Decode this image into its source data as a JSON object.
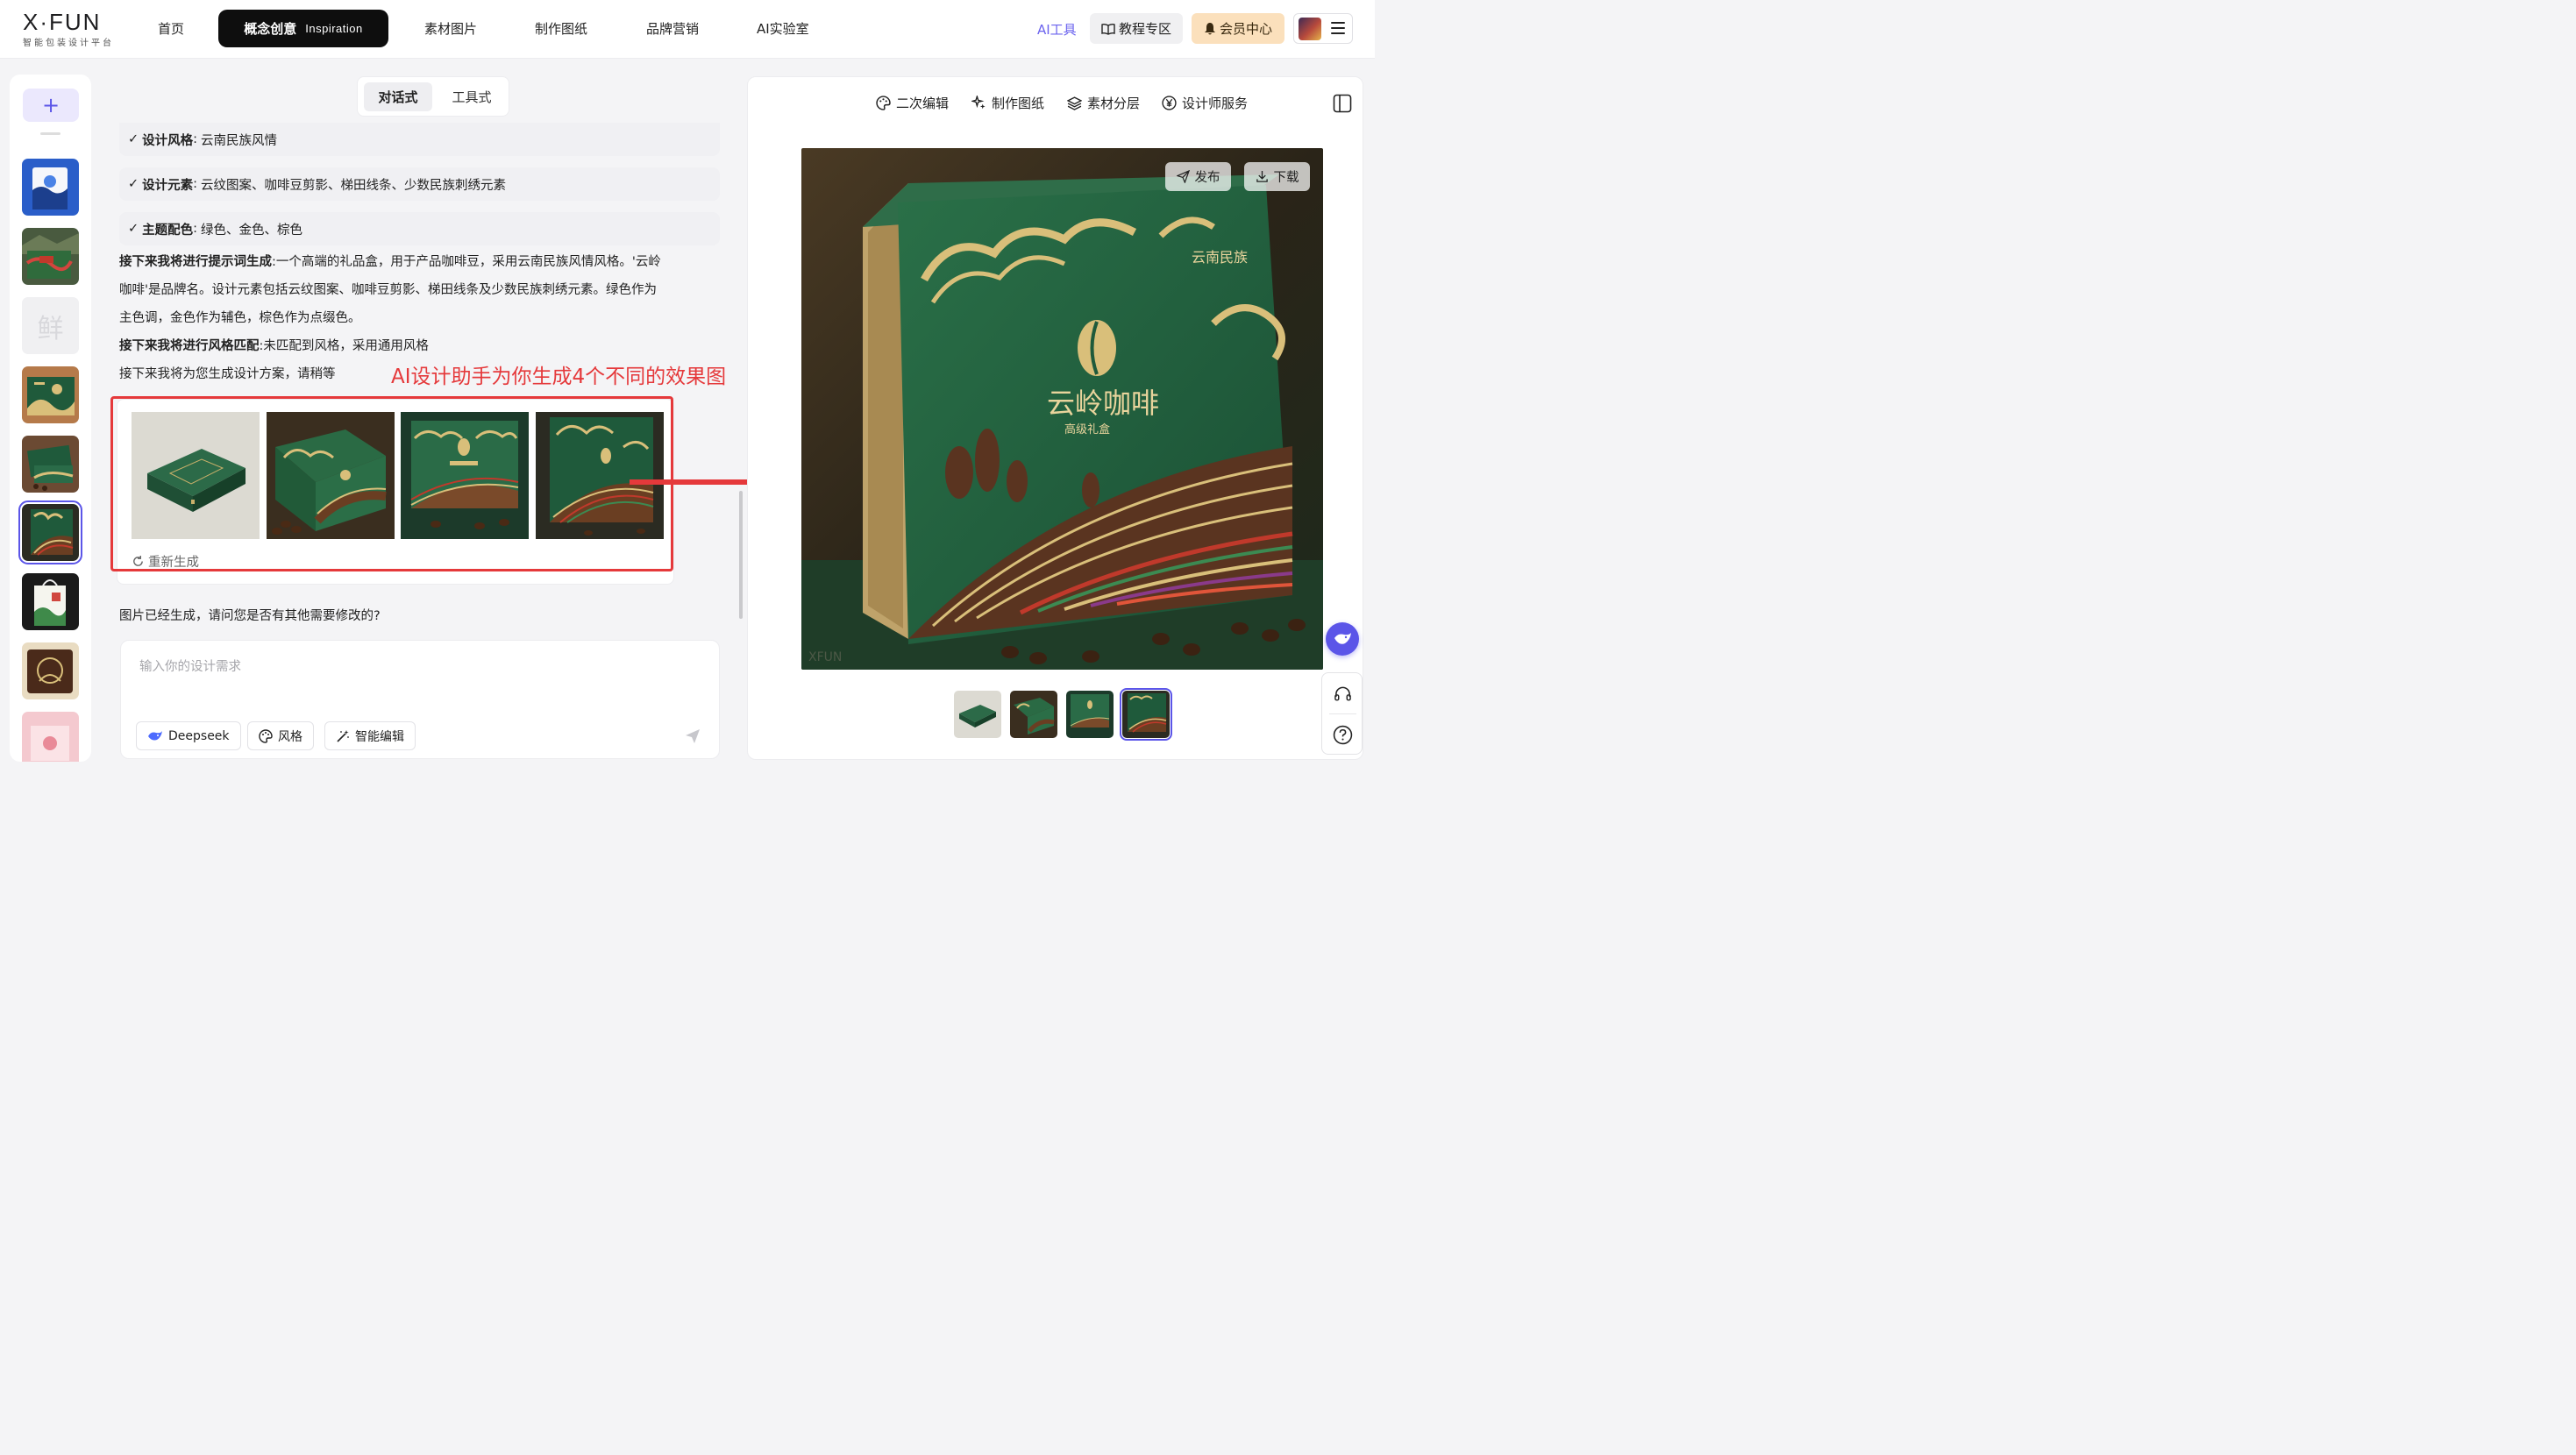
{
  "header": {
    "logo_main": "X·FUN",
    "logo_sub": "智能包装设计平台",
    "nav": [
      "首页",
      "制作图纸",
      "品牌营销",
      "AI实验室"
    ],
    "nav_materials": "素材图片",
    "active_tab": {
      "zh": "概念创意",
      "en": "Inspiration"
    },
    "ai_tools": "AI工具",
    "tutorial": "教程专区",
    "member": "会员中心",
    "accent_color": "#5b55e8"
  },
  "sidebar": {
    "add_label": "+",
    "placeholder_char": "鲜"
  },
  "chat": {
    "mode_tabs": [
      "对话式",
      "工具式"
    ],
    "tags": [
      {
        "label": "设计风格",
        "value": "云南民族风情"
      },
      {
        "label": "设计元素",
        "value": "云纹图案、咖啡豆剪影、梯田线条、少数民族刺绣元素"
      },
      {
        "label": "主题配色",
        "value": "绿色、金色、棕色"
      }
    ],
    "prompt_title": "接下来我将进行提示词生成",
    "prompt_text_1": ":一个高端的礼品盒，用于产品咖啡豆，采用云南民族风情风格。'云岭",
    "prompt_text_2": "咖啡'是品牌名。设计元素包括云纹图案、咖啡豆剪影、梯田线条及少数民族刺绣元素。绿色作为",
    "prompt_text_3": "主色调，金色作为辅色，棕色作为点缀色。",
    "style_title": "接下来我将进行风格匹配",
    "style_text": ":未匹配到风格，采用通用风格",
    "waiting_text": "接下来我将为您生成设计方案，请稍等",
    "annotation": "AI设计助手为你生成4个不同的效果图",
    "regenerate": "重新生成",
    "followup": "图片已经生成，请问您是否有其他需要修改的?",
    "input_placeholder": "输入你的设计需求",
    "chips": [
      "Deepseek",
      "风格",
      "智能编辑"
    ]
  },
  "preview": {
    "tools": [
      "二次编辑",
      "制作图纸",
      "素材分层",
      "设计师服务"
    ],
    "publish": "发布",
    "download": "下载",
    "box_brand": "云岭咖啡",
    "box_sub": "高级礼盒",
    "box_corner": "云南民族",
    "watermark": "XFUN",
    "box_colors": {
      "green": "#1f5a3b",
      "gold": "#d9bf7a",
      "brown": "#5a3420"
    }
  }
}
